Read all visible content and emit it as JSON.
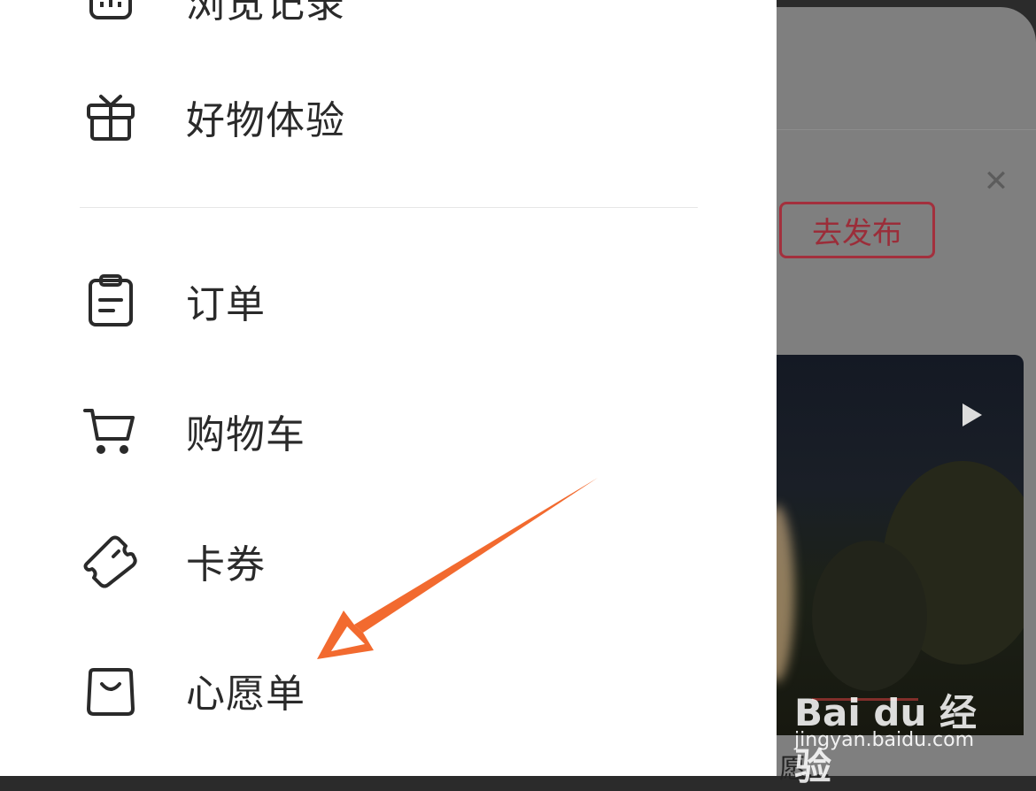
{
  "drawer": {
    "top_item_label": "浏览记录",
    "gift_label": "好物体验",
    "orders_label": "订单",
    "cart_label": "购物车",
    "coupons_label": "卡券",
    "wishlist_label": "心愿单"
  },
  "right_page": {
    "publish_button": "去发布",
    "card_caption": "愿..."
  },
  "watermark": {
    "logo": "Bai du 经验",
    "url": "jingyan.baidu.com"
  },
  "colors": {
    "accent_red": "#a3303d",
    "arrow_orange": "#f26a2f"
  }
}
